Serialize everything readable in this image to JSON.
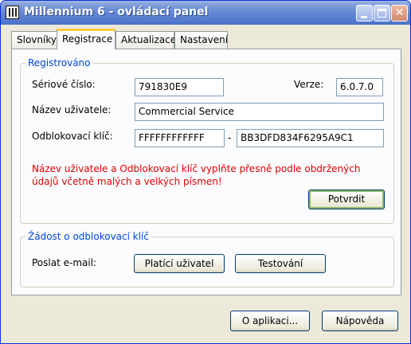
{
  "window": {
    "title": "Millennium 6 - ovládací panel"
  },
  "tabs": [
    {
      "label": "Slovníky"
    },
    {
      "label": "Registrace"
    },
    {
      "label": "Aktualizace"
    },
    {
      "label": "Nastavení"
    }
  ],
  "registration": {
    "legend": "Registrováno",
    "serial_label": "Sériové číslo:",
    "serial_value": "791830E9",
    "version_label": "Verze:",
    "version_value": "6.0.7.0",
    "username_label": "Název uživatele:",
    "username_value": "Commercial Service",
    "unlock_label": "Odblokovací klíč:",
    "unlock_value_1": "FFFFFFFFFFFF",
    "unlock_separator": "-",
    "unlock_value_2": "BB3DFD834F6295A9C1",
    "warning_line1": "Název uživatele a Odblokovací klíč vyplňte přesně podle obdržených",
    "warning_line2": "údajů včetně malých a velkých písmen!",
    "confirm_label": "Potvrdit"
  },
  "request": {
    "legend": "Žádost o odblokovací klíč",
    "send_label": "Poslat e-mail:",
    "paying_label": "Platící uživatel",
    "testing_label": "Testování"
  },
  "footer": {
    "about_label": "O aplikaci...",
    "help_label": "Nápověda"
  }
}
